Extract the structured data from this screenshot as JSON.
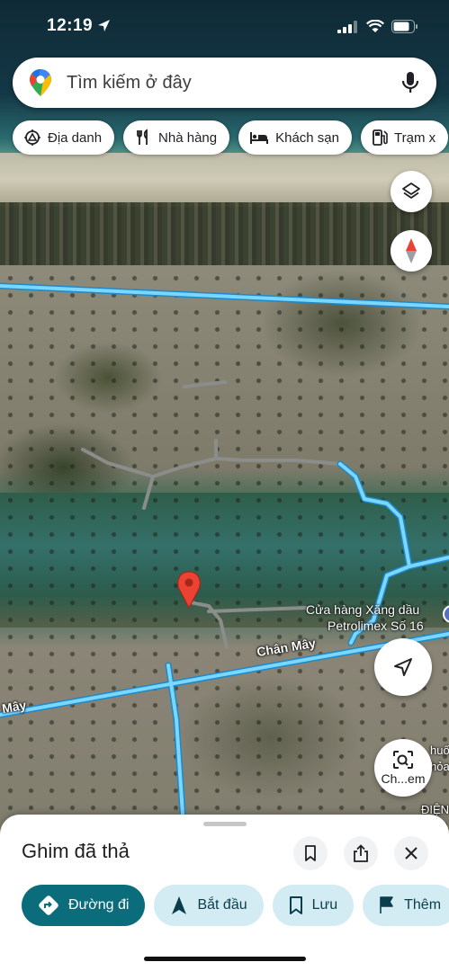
{
  "status_bar": {
    "time": "12:19",
    "location_icon": "location-arrow-icon",
    "signal_icon": "cellular-signal-icon",
    "wifi_icon": "wifi-icon",
    "battery_icon": "battery-icon"
  },
  "search": {
    "placeholder": "Tìm kiếm ở đây",
    "logo_icon": "google-maps-pin-icon",
    "mic_icon": "microphone-icon"
  },
  "chips": [
    {
      "label": "Địa danh",
      "icon": "landmark-icon"
    },
    {
      "label": "Nhà hàng",
      "icon": "fork-knife-icon"
    },
    {
      "label": "Khách sạn",
      "icon": "bed-icon"
    },
    {
      "label": "Trạm x",
      "icon": "gas-station-icon"
    }
  ],
  "map": {
    "road_label_1": "Chân Mây",
    "road_label_2": "Mây",
    "poi_name_line1": "Cửa hàng Xăng dầu",
    "poi_name_line2": "Petrolimex Số 16",
    "poi_partial_1": "huốc",
    "poi_partial_2": "hỏa",
    "poi_partial_3": "ĐIỆN",
    "road_color": "#4fc3f7",
    "pin_color": "#ea4335"
  },
  "buttons": {
    "layers_icon": "layers-icon",
    "compass_icon": "compass-icon",
    "location_icon": "my-location-icon",
    "lens_label": "Ch...em",
    "lens_icon": "camera-search-icon"
  },
  "sheet": {
    "title": "Ghim đã thả",
    "actions": [
      {
        "label": "Đường đi",
        "icon": "directions-icon"
      },
      {
        "label": "Bắt đầu",
        "icon": "navigation-arrow-icon"
      },
      {
        "label": "Lưu",
        "icon": "bookmark-icon"
      },
      {
        "label": "Thêm",
        "icon": "flag-icon"
      }
    ]
  }
}
